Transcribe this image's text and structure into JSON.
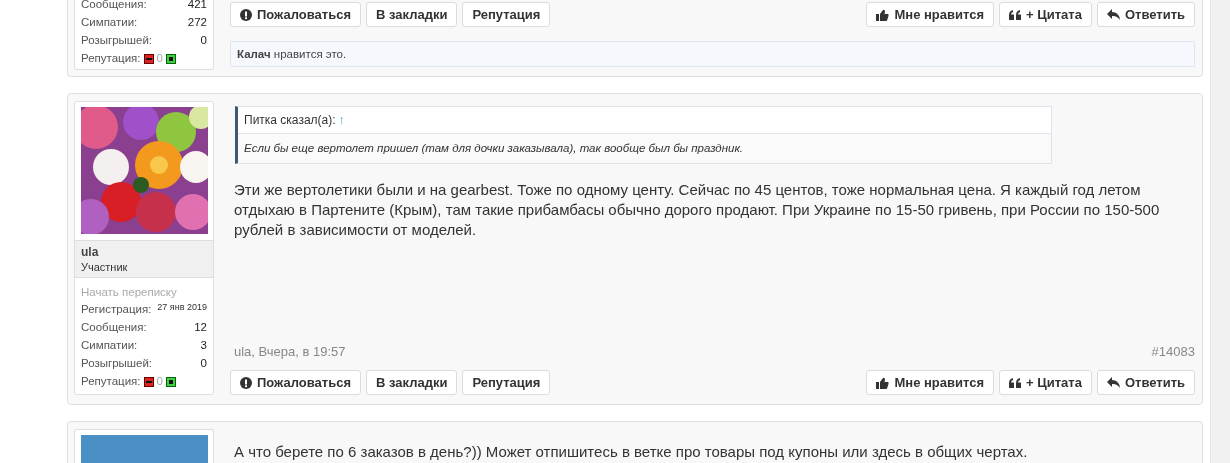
{
  "posts": [
    {
      "user": {
        "stats": [
          {
            "label": "Сообщения:",
            "value": "421"
          },
          {
            "label": "Симпатии:",
            "value": "272"
          },
          {
            "label": "Розыгрышей:",
            "value": "0"
          }
        ],
        "reputation": {
          "label": "Репутация:",
          "value": "0"
        }
      },
      "actions_left": [
        {
          "kind": "report",
          "label": "Пожаловаться"
        },
        {
          "kind": "plain",
          "label": "В закладки"
        },
        {
          "kind": "plain",
          "label": "Репутация"
        }
      ],
      "actions_right": [
        {
          "kind": "like",
          "label": "Мне нравится"
        },
        {
          "kind": "quote",
          "label": "+ Цитата"
        },
        {
          "kind": "reply",
          "label": "Ответить"
        }
      ],
      "likes": "**Калач** нравится это."
    },
    {
      "user": {
        "name": "ula",
        "role": "Участник",
        "start_conversation": "Начать переписку",
        "registration": {
          "label": "Регистрация:",
          "value": "27 янв 2019"
        },
        "stats": [
          {
            "label": "Сообщения:",
            "value": "12"
          },
          {
            "label": "Симпатии:",
            "value": "3"
          },
          {
            "label": "Розыгрышей:",
            "value": "0"
          }
        ],
        "reputation": {
          "label": "Репутация:",
          "value": "0"
        }
      },
      "quote": {
        "author": "Питка сказал(а):",
        "arrow": "↑",
        "text": "Если бы еще вертолет пришел (там для дочки заказывала), так вообще был бы праздник."
      },
      "body": "Эти же вертолетики были и на gearbest. Тоже по одному центу. Сейчас по 45 центов, тоже нормальная цена. Я каждый год летом отдыхаю в Партените (Крым), там такие прибамбасы обычно дорого продают. При Украине по 15-50 гривень, при России по 150-500 рублей в зависимости от моделей.",
      "date": "ula, Вчера, в 19:57",
      "number": "#14083",
      "actions_left": [
        {
          "kind": "report",
          "label": "Пожаловаться"
        },
        {
          "kind": "plain",
          "label": "В закладки"
        },
        {
          "kind": "plain",
          "label": "Репутация"
        }
      ],
      "actions_right": [
        {
          "kind": "like",
          "label": "Мне нравится"
        },
        {
          "kind": "quote",
          "label": "+ Цитата"
        },
        {
          "kind": "reply",
          "label": "Ответить"
        }
      ]
    },
    {
      "user": {
        "avatar": {
          "kind": "plain",
          "color": "#4a90c4"
        }
      },
      "body": "А что берете по 6 заказов в день?)) Может отпишитесь в ветке про товары под купоны или здесь в общих чертах."
    }
  ]
}
